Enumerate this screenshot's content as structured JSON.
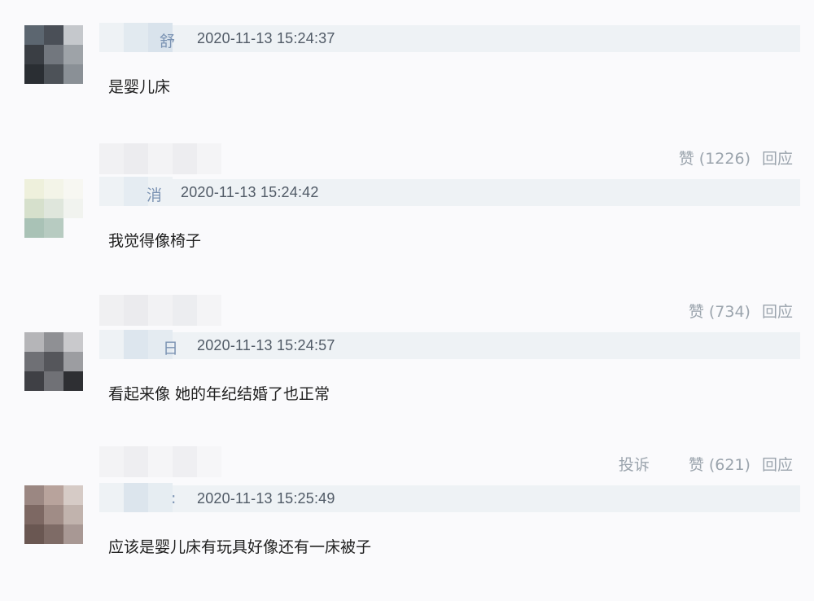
{
  "comments": [
    {
      "name_tail": "舒",
      "timestamp": "2020-11-13 15:24:37",
      "content": "是婴儿床",
      "actions": {
        "report": "",
        "like": "赞 (1226)",
        "reply": "回应"
      }
    },
    {
      "name_tail": "消",
      "timestamp": "2020-11-13 15:24:42",
      "content": "我觉得像椅子",
      "actions": {
        "report": "",
        "like": "赞 (734)",
        "reply": "回应"
      }
    },
    {
      "name_tail": "日",
      "timestamp": "2020-11-13 15:24:57",
      "content": "看起来像 她的年纪结婚了也正常",
      "actions": {
        "report": "投诉",
        "like": "赞 (621)",
        "reply": "回应"
      }
    },
    {
      "name_tail": ":",
      "timestamp": "2020-11-13 15:25:49",
      "content": "应该是婴儿床有玩具好像还有一床被子",
      "actions": null
    }
  ],
  "colors": {
    "header_bg": "#eef2f5",
    "username": "#7b93b3",
    "timestamp": "#505a66",
    "actions": "#9ba4ad"
  }
}
